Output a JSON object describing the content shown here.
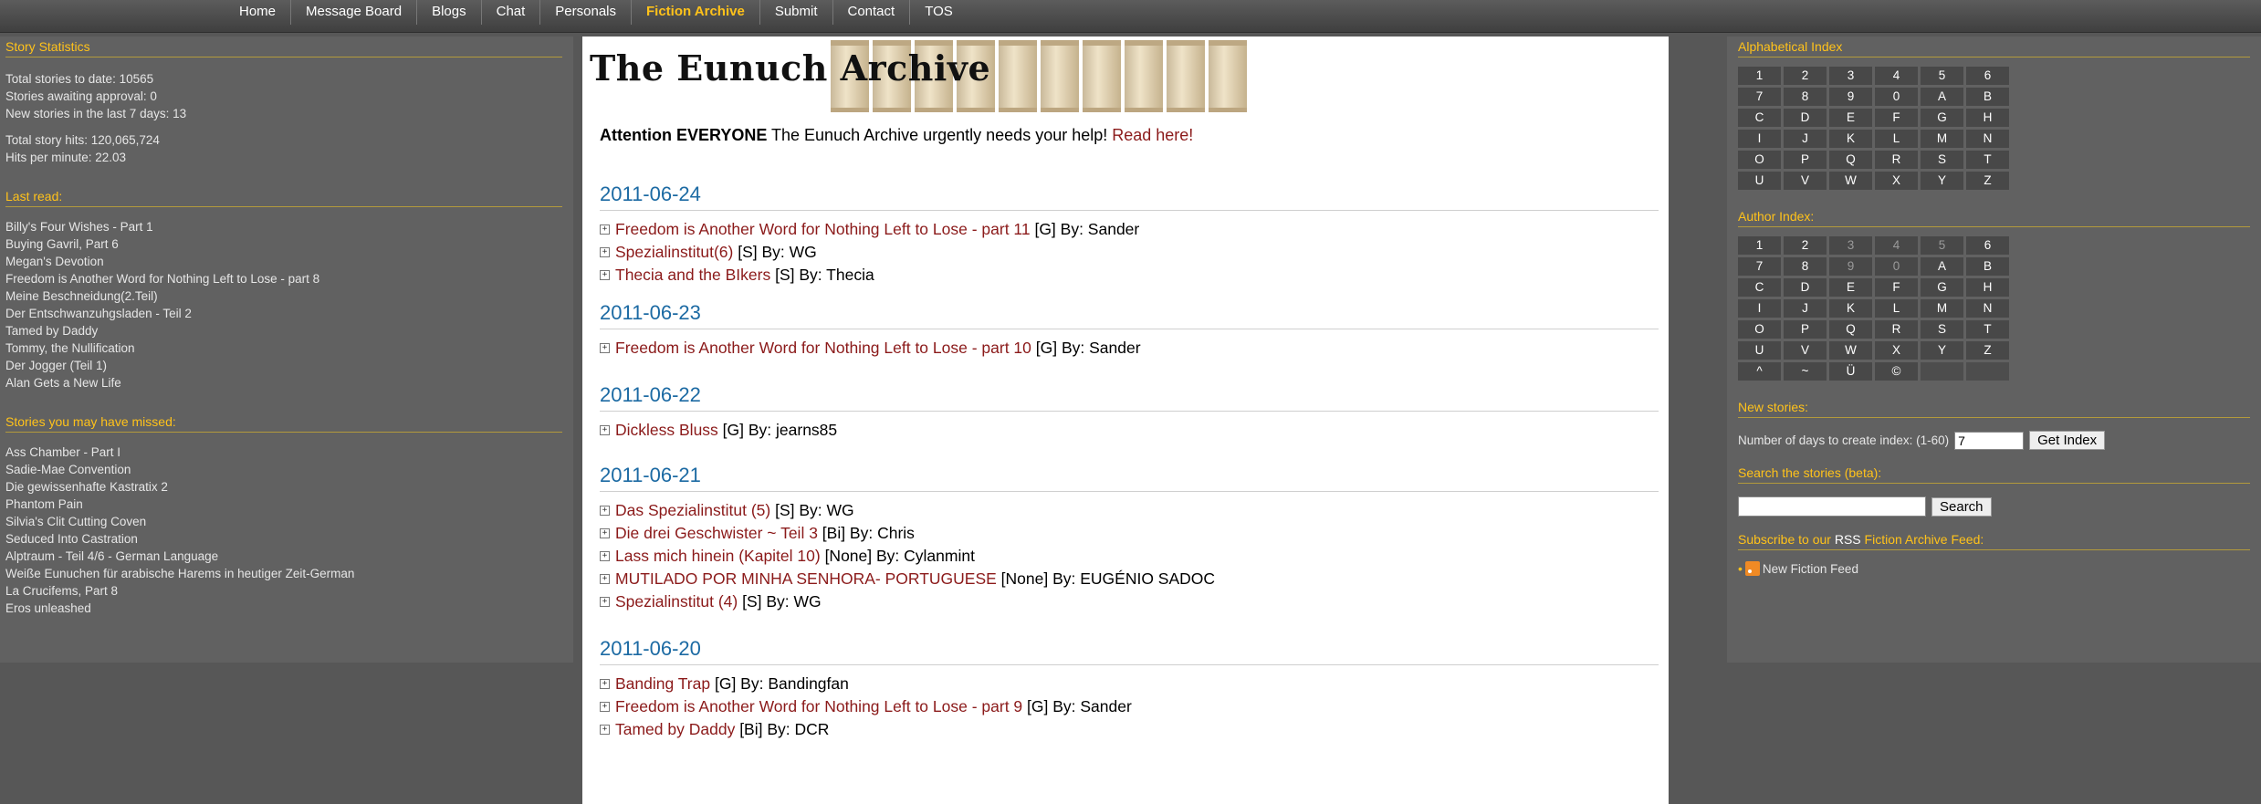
{
  "nav": [
    "Home",
    "Message Board",
    "Blogs",
    "Chat",
    "Personals",
    "Fiction Archive",
    "Submit",
    "Contact",
    "TOS"
  ],
  "nav_active": "Fiction Archive",
  "left": {
    "stats_title": "Story Statistics",
    "stats": [
      "Total stories to date: 10565",
      "Stories awaiting approval: 0",
      "New stories in the last 7 days: 13"
    ],
    "hits": [
      "Total story hits: 120,065,724",
      "Hits per minute: 22.03"
    ],
    "last_read_title": "Last read:",
    "last_read": [
      "Billy's Four Wishes - Part 1",
      "Buying Gavril, Part 6",
      "Megan's Devotion",
      "Freedom is Another Word for Nothing Left to Lose - part 8",
      "Meine Beschneidung(2.Teil)",
      "Der Entschwanzuhgsladen - Teil 2",
      "Tamed by Daddy",
      "Tommy, the Nullification",
      "Der Jogger (Teil 1)",
      "Alan Gets a New Life"
    ],
    "missed_title": "Stories you may have missed:",
    "missed": [
      "Ass Chamber - Part I",
      "Sadie-Mae Convention",
      "Die gewissenhafte Kastratix 2",
      "Phantom Pain",
      "Silvia's Clit Cutting Coven",
      "Seduced Into Castration",
      "Alptraum - Teil 4/6 - German Language",
      "Weiße Eunuchen für arabische Harems in heutiger Zeit-German",
      "La Crucifems, Part 8",
      "Eros unleashed"
    ]
  },
  "main": {
    "logo_text": "The Eunuch Archive",
    "attn_bold": "Attention EVERYONE",
    "attn_text": " The Eunuch Archive urgently needs your help! ",
    "attn_link": "Read here!",
    "days": [
      {
        "date": "2011-06-24",
        "stories": [
          {
            "title": "Freedom is Another Word for Nothing Left to Lose - part 11",
            "meta": " [G] By: Sander"
          },
          {
            "title": "Spezialinstitut(6)",
            "meta": " [S] By: WG"
          },
          {
            "title": "Thecia and the BIkers",
            "meta": " [S] By: Thecia"
          }
        ]
      },
      {
        "date": "2011-06-23",
        "stories": [
          {
            "title": "Freedom is Another Word for Nothing Left to Lose - part 10",
            "meta": " [G] By: Sander"
          }
        ]
      },
      {
        "date": "2011-06-22",
        "stories": [
          {
            "title": "Dickless Bluss",
            "meta": " [G] By: jearns85"
          }
        ]
      },
      {
        "date": "2011-06-21",
        "stories": [
          {
            "title": "Das Spezialinstitut (5)",
            "meta": " [S] By: WG"
          },
          {
            "title": "Die drei Geschwister ~ Teil 3",
            "meta": " [Bi] By: Chris"
          },
          {
            "title": "Lass mich hinein (Kapitel 10)",
            "meta": " [None] By: Cylanmint"
          },
          {
            "title": "MUTILADO POR MINHA SENHORA- PORTUGUESE",
            "meta": " [None] By: EUGÉNIO SADOC"
          },
          {
            "title": "Spezialinstitut (4)",
            "meta": " [S] By: WG"
          }
        ]
      },
      {
        "date": "2011-06-20",
        "stories": [
          {
            "title": "Banding Trap",
            "meta": " [G] By: Bandingfan"
          },
          {
            "title": "Freedom is Another Word for Nothing Left to Lose - part 9",
            "meta": " [G] By: Sander"
          },
          {
            "title": "Tamed by Daddy",
            "meta": " [Bi] By: DCR"
          }
        ]
      }
    ]
  },
  "right": {
    "alpha_title": "Alphabetical Index",
    "alpha": [
      "1",
      "2",
      "3",
      "4",
      "5",
      "6",
      "7",
      "8",
      "9",
      "0",
      "A",
      "B",
      "C",
      "D",
      "E",
      "F",
      "G",
      "H",
      "I",
      "J",
      "K",
      "L",
      "M",
      "N",
      "O",
      "P",
      "Q",
      "R",
      "S",
      "T",
      "U",
      "V",
      "W",
      "X",
      "Y",
      "Z"
    ],
    "author_title": "Author Index:",
    "author": [
      "1",
      "2",
      "3",
      "4",
      "5",
      "6",
      "7",
      "8",
      "9",
      "0",
      "A",
      "B",
      "C",
      "D",
      "E",
      "F",
      "G",
      "H",
      "I",
      "J",
      "K",
      "L",
      "M",
      "N",
      "O",
      "P",
      "Q",
      "R",
      "S",
      "T",
      "U",
      "V",
      "W",
      "X",
      "Y",
      "Z",
      "^",
      "~",
      "Ü",
      "©",
      "",
      ""
    ],
    "author_dim": [
      "3",
      "4",
      "5",
      "9",
      "0"
    ],
    "new_title": "New stories:",
    "new_label": "Number of days to create index: (1-60)",
    "new_value": "7",
    "new_button": "Get Index",
    "search_title": "Search the stories (beta):",
    "search_button": "Search",
    "sub_prefix": "Subscribe to our ",
    "sub_rss": "RSS",
    "sub_suffix": " Fiction Archive Feed:",
    "feed_label": "New Fiction Feed"
  }
}
